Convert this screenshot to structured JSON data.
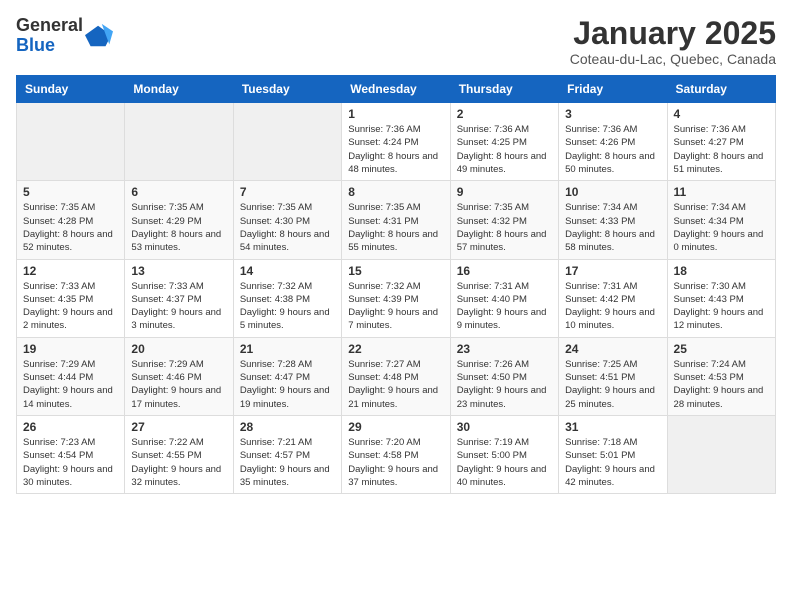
{
  "header": {
    "logo_line1": "General",
    "logo_line2": "Blue",
    "title": "January 2025",
    "subtitle": "Coteau-du-Lac, Quebec, Canada"
  },
  "weekdays": [
    "Sunday",
    "Monday",
    "Tuesday",
    "Wednesday",
    "Thursday",
    "Friday",
    "Saturday"
  ],
  "weeks": [
    [
      {
        "num": "",
        "sunrise": "",
        "sunset": "",
        "daylight": "",
        "empty": true
      },
      {
        "num": "",
        "sunrise": "",
        "sunset": "",
        "daylight": "",
        "empty": true
      },
      {
        "num": "",
        "sunrise": "",
        "sunset": "",
        "daylight": "",
        "empty": true
      },
      {
        "num": "1",
        "sunrise": "Sunrise: 7:36 AM",
        "sunset": "Sunset: 4:24 PM",
        "daylight": "Daylight: 8 hours and 48 minutes."
      },
      {
        "num": "2",
        "sunrise": "Sunrise: 7:36 AM",
        "sunset": "Sunset: 4:25 PM",
        "daylight": "Daylight: 8 hours and 49 minutes."
      },
      {
        "num": "3",
        "sunrise": "Sunrise: 7:36 AM",
        "sunset": "Sunset: 4:26 PM",
        "daylight": "Daylight: 8 hours and 50 minutes."
      },
      {
        "num": "4",
        "sunrise": "Sunrise: 7:36 AM",
        "sunset": "Sunset: 4:27 PM",
        "daylight": "Daylight: 8 hours and 51 minutes."
      }
    ],
    [
      {
        "num": "5",
        "sunrise": "Sunrise: 7:35 AM",
        "sunset": "Sunset: 4:28 PM",
        "daylight": "Daylight: 8 hours and 52 minutes."
      },
      {
        "num": "6",
        "sunrise": "Sunrise: 7:35 AM",
        "sunset": "Sunset: 4:29 PM",
        "daylight": "Daylight: 8 hours and 53 minutes."
      },
      {
        "num": "7",
        "sunrise": "Sunrise: 7:35 AM",
        "sunset": "Sunset: 4:30 PM",
        "daylight": "Daylight: 8 hours and 54 minutes."
      },
      {
        "num": "8",
        "sunrise": "Sunrise: 7:35 AM",
        "sunset": "Sunset: 4:31 PM",
        "daylight": "Daylight: 8 hours and 55 minutes."
      },
      {
        "num": "9",
        "sunrise": "Sunrise: 7:35 AM",
        "sunset": "Sunset: 4:32 PM",
        "daylight": "Daylight: 8 hours and 57 minutes."
      },
      {
        "num": "10",
        "sunrise": "Sunrise: 7:34 AM",
        "sunset": "Sunset: 4:33 PM",
        "daylight": "Daylight: 8 hours and 58 minutes."
      },
      {
        "num": "11",
        "sunrise": "Sunrise: 7:34 AM",
        "sunset": "Sunset: 4:34 PM",
        "daylight": "Daylight: 9 hours and 0 minutes."
      }
    ],
    [
      {
        "num": "12",
        "sunrise": "Sunrise: 7:33 AM",
        "sunset": "Sunset: 4:35 PM",
        "daylight": "Daylight: 9 hours and 2 minutes."
      },
      {
        "num": "13",
        "sunrise": "Sunrise: 7:33 AM",
        "sunset": "Sunset: 4:37 PM",
        "daylight": "Daylight: 9 hours and 3 minutes."
      },
      {
        "num": "14",
        "sunrise": "Sunrise: 7:32 AM",
        "sunset": "Sunset: 4:38 PM",
        "daylight": "Daylight: 9 hours and 5 minutes."
      },
      {
        "num": "15",
        "sunrise": "Sunrise: 7:32 AM",
        "sunset": "Sunset: 4:39 PM",
        "daylight": "Daylight: 9 hours and 7 minutes."
      },
      {
        "num": "16",
        "sunrise": "Sunrise: 7:31 AM",
        "sunset": "Sunset: 4:40 PM",
        "daylight": "Daylight: 9 hours and 9 minutes."
      },
      {
        "num": "17",
        "sunrise": "Sunrise: 7:31 AM",
        "sunset": "Sunset: 4:42 PM",
        "daylight": "Daylight: 9 hours and 10 minutes."
      },
      {
        "num": "18",
        "sunrise": "Sunrise: 7:30 AM",
        "sunset": "Sunset: 4:43 PM",
        "daylight": "Daylight: 9 hours and 12 minutes."
      }
    ],
    [
      {
        "num": "19",
        "sunrise": "Sunrise: 7:29 AM",
        "sunset": "Sunset: 4:44 PM",
        "daylight": "Daylight: 9 hours and 14 minutes."
      },
      {
        "num": "20",
        "sunrise": "Sunrise: 7:29 AM",
        "sunset": "Sunset: 4:46 PM",
        "daylight": "Daylight: 9 hours and 17 minutes."
      },
      {
        "num": "21",
        "sunrise": "Sunrise: 7:28 AM",
        "sunset": "Sunset: 4:47 PM",
        "daylight": "Daylight: 9 hours and 19 minutes."
      },
      {
        "num": "22",
        "sunrise": "Sunrise: 7:27 AM",
        "sunset": "Sunset: 4:48 PM",
        "daylight": "Daylight: 9 hours and 21 minutes."
      },
      {
        "num": "23",
        "sunrise": "Sunrise: 7:26 AM",
        "sunset": "Sunset: 4:50 PM",
        "daylight": "Daylight: 9 hours and 23 minutes."
      },
      {
        "num": "24",
        "sunrise": "Sunrise: 7:25 AM",
        "sunset": "Sunset: 4:51 PM",
        "daylight": "Daylight: 9 hours and 25 minutes."
      },
      {
        "num": "25",
        "sunrise": "Sunrise: 7:24 AM",
        "sunset": "Sunset: 4:53 PM",
        "daylight": "Daylight: 9 hours and 28 minutes."
      }
    ],
    [
      {
        "num": "26",
        "sunrise": "Sunrise: 7:23 AM",
        "sunset": "Sunset: 4:54 PM",
        "daylight": "Daylight: 9 hours and 30 minutes."
      },
      {
        "num": "27",
        "sunrise": "Sunrise: 7:22 AM",
        "sunset": "Sunset: 4:55 PM",
        "daylight": "Daylight: 9 hours and 32 minutes."
      },
      {
        "num": "28",
        "sunrise": "Sunrise: 7:21 AM",
        "sunset": "Sunset: 4:57 PM",
        "daylight": "Daylight: 9 hours and 35 minutes."
      },
      {
        "num": "29",
        "sunrise": "Sunrise: 7:20 AM",
        "sunset": "Sunset: 4:58 PM",
        "daylight": "Daylight: 9 hours and 37 minutes."
      },
      {
        "num": "30",
        "sunrise": "Sunrise: 7:19 AM",
        "sunset": "Sunset: 5:00 PM",
        "daylight": "Daylight: 9 hours and 40 minutes."
      },
      {
        "num": "31",
        "sunrise": "Sunrise: 7:18 AM",
        "sunset": "Sunset: 5:01 PM",
        "daylight": "Daylight: 9 hours and 42 minutes."
      },
      {
        "num": "",
        "sunrise": "",
        "sunset": "",
        "daylight": "",
        "empty": true
      }
    ]
  ]
}
